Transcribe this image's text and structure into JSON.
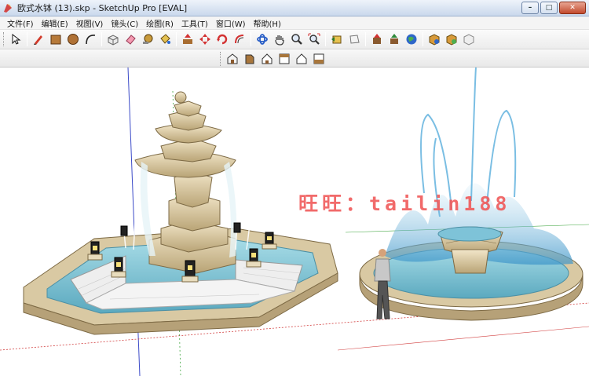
{
  "window": {
    "title": "欧式水钵 (13).skp - SketchUp Pro [EVAL]",
    "minimize_label": "–",
    "maximize_label": "□",
    "close_label": "✕"
  },
  "menu": [
    "文件(F)",
    "编辑(E)",
    "视图(V)",
    "镜头(C)",
    "绘图(R)",
    "工具(T)",
    "窗口(W)",
    "帮助(H)"
  ],
  "toolbar_main": [
    "select-tool",
    "pencil-tool",
    "rectangle-tool",
    "circle-tool",
    "arc-tool",
    "make-component-tool",
    "eraser-tool",
    "tape-measure-tool",
    "paint-bucket-tool",
    "push-pull-tool",
    "move-tool",
    "rotate-tool",
    "offset-tool",
    "orbit-tool",
    "pan-tool",
    "zoom-tool",
    "zoom-extents-tool",
    "previous-view-tool",
    "next-view-tool",
    "get-models-tool",
    "share-model-tool",
    "google-earth-tool",
    "component-library-tool",
    "share-component-tool",
    "extension-tool"
  ],
  "toolbar_views": [
    "iso-view",
    "front-view",
    "back-view",
    "right-view",
    "left-view",
    "top-view"
  ],
  "watermark": "旺旺：tailin188",
  "colors": {
    "accent_red": "#f05a5a",
    "stone": "#d7c6a0",
    "water": "#7fc4d6",
    "axis_red": "#d24040",
    "axis_blue": "#3c4bc8",
    "axis_green": "#3fa53f"
  }
}
